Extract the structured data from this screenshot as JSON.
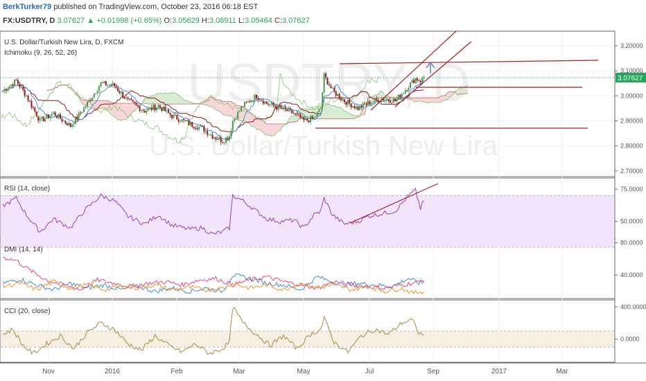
{
  "header": {
    "author": "BerkTurker79",
    "published": "published on TradingView.com, October 23, 2016 06:18 EST",
    "symbol": "FX:USDTRY, D",
    "last": "3.07627",
    "change": "+0.01998 (+0.65%)",
    "o_label": "O:",
    "o_value": "3.05629",
    "h_label": "H:",
    "h_value": "3.08911",
    "l_label": "L:",
    "l_value": "3.05464",
    "c_label": "C:",
    "c_value": "3.07627"
  },
  "colors": {
    "candle_up": "#4a9a4a",
    "candle_down": "#8b1a1a",
    "cloud_green": "#d8ecd2",
    "cloud_red": "#f6d6d6",
    "rsi": "#9b3fb3",
    "dmi_plus": "#3b8fd9",
    "dmi_minus": "#e8467c",
    "adx": "#f0922b",
    "cci": "#a88a3e",
    "trendline": "#a31d2a",
    "price_tag": "#26a65b"
  },
  "chart_data": [
    {
      "type": "candlestick",
      "title": "U.S. Dollar/Turkish New Lira, D, FXCM",
      "indicator": "Ichimoku (9, 26, 52, 26)",
      "watermark_symbol": "USDTRY, D",
      "watermark_name": "U.S. Dollar/Turkish New Lira",
      "y_ticks": [
        "3.20000",
        "3.10000",
        "3.00000",
        "2.90000",
        "2.80000",
        "2.70000"
      ],
      "ylim": [
        2.68,
        3.25
      ],
      "last_price_tag": "3.07627",
      "x_ticks": [
        "Nov",
        "2016",
        "Feb",
        "Mar",
        "May",
        "Jul",
        "Sep",
        "Nov",
        "2017",
        "Mar"
      ],
      "price_anchors": [
        [
          0,
          3.02
        ],
        [
          8,
          3.06
        ],
        [
          14,
          3.0
        ],
        [
          22,
          2.9
        ],
        [
          30,
          2.93
        ],
        [
          40,
          2.88
        ],
        [
          48,
          2.95
        ],
        [
          58,
          3.05
        ],
        [
          66,
          3.04
        ],
        [
          74,
          2.98
        ],
        [
          84,
          2.94
        ],
        [
          92,
          2.96
        ],
        [
          100,
          2.92
        ],
        [
          110,
          2.89
        ],
        [
          118,
          2.87
        ],
        [
          124,
          2.84
        ],
        [
          130,
          2.82
        ],
        [
          134,
          2.84
        ],
        [
          136,
          2.9
        ],
        [
          142,
          2.96
        ],
        [
          150,
          3.0
        ],
        [
          156,
          2.97
        ],
        [
          164,
          2.95
        ],
        [
          172,
          2.93
        ],
        [
          178,
          2.9
        ],
        [
          184,
          2.91
        ],
        [
          188,
          2.95
        ],
        [
          190,
          3.08
        ],
        [
          195,
          3.02
        ],
        [
          202,
          2.98
        ],
        [
          210,
          2.95
        ],
        [
          216,
          2.97
        ],
        [
          224,
          2.99
        ],
        [
          232,
          2.98
        ],
        [
          240,
          3.04
        ],
        [
          244,
          3.07
        ],
        [
          247,
          3.06
        ],
        [
          249,
          3.076
        ]
      ],
      "future_labels": [
        "Nov",
        "2017",
        "Mar"
      ]
    },
    {
      "type": "line",
      "title": "RSI (14, close)",
      "y_ticks": [
        "75.0000",
        "50.0000"
      ],
      "ylim": [
        38,
        82
      ],
      "band": [
        30,
        70
      ],
      "series": [
        {
          "anchors": [
            [
              0,
              62
            ],
            [
              8,
              68
            ],
            [
              14,
              55
            ],
            [
              22,
              42
            ],
            [
              30,
              52
            ],
            [
              40,
              45
            ],
            [
              48,
              58
            ],
            [
              58,
              70
            ],
            [
              66,
              66
            ],
            [
              74,
              54
            ],
            [
              84,
              48
            ],
            [
              92,
              55
            ],
            [
              100,
              47
            ],
            [
              110,
              44
            ],
            [
              118,
              45
            ],
            [
              124,
              40
            ],
            [
              130,
              42
            ],
            [
              134,
              45
            ],
            [
              136,
              70
            ],
            [
              142,
              66
            ],
            [
              150,
              58
            ],
            [
              156,
              52
            ],
            [
              164,
              50
            ],
            [
              172,
              51
            ],
            [
              178,
              45
            ],
            [
              184,
              55
            ],
            [
              188,
              58
            ],
            [
              190,
              68
            ],
            [
              195,
              55
            ],
            [
              202,
              48
            ],
            [
              210,
              50
            ],
            [
              216,
              54
            ],
            [
              224,
              56
            ],
            [
              232,
              58
            ],
            [
              240,
              70
            ],
            [
              244,
              74
            ],
            [
              247,
              60
            ],
            [
              249,
              66
            ]
          ]
        }
      ]
    },
    {
      "type": "line",
      "title": "DMI (14, 14)",
      "y_ticks": [
        "80.0000",
        "40.0000"
      ],
      "ylim": [
        12,
        82
      ],
      "series": [
        {
          "name": "+DI",
          "anchors": [
            [
              0,
              30
            ],
            [
              10,
              35
            ],
            [
              20,
              28
            ],
            [
              30,
              22
            ],
            [
              40,
              30
            ],
            [
              50,
              24
            ],
            [
              60,
              28
            ],
            [
              70,
              22
            ],
            [
              80,
              26
            ],
            [
              90,
              20
            ],
            [
              100,
              24
            ],
            [
              110,
              20
            ],
            [
              120,
              24
            ],
            [
              130,
              20
            ],
            [
              136,
              40
            ],
            [
              146,
              36
            ],
            [
              156,
              30
            ],
            [
              166,
              28
            ],
            [
              176,
              22
            ],
            [
              186,
              38
            ],
            [
              192,
              34
            ],
            [
              200,
              28
            ],
            [
              210,
              30
            ],
            [
              220,
              28
            ],
            [
              230,
              26
            ],
            [
              240,
              36
            ],
            [
              246,
              30
            ],
            [
              249,
              34
            ]
          ]
        },
        {
          "name": "-DI",
          "anchors": [
            [
              0,
              62
            ],
            [
              8,
              58
            ],
            [
              16,
              46
            ],
            [
              26,
              34
            ],
            [
              36,
              28
            ],
            [
              46,
              22
            ],
            [
              56,
              34
            ],
            [
              66,
              30
            ],
            [
              76,
              26
            ],
            [
              86,
              30
            ],
            [
              96,
              32
            ],
            [
              106,
              28
            ],
            [
              116,
              34
            ],
            [
              126,
              36
            ],
            [
              136,
              28
            ],
            [
              146,
              34
            ],
            [
              156,
              38
            ],
            [
              166,
              32
            ],
            [
              176,
              28
            ],
            [
              186,
              24
            ],
            [
              196,
              32
            ],
            [
              206,
              28
            ],
            [
              216,
              26
            ],
            [
              226,
              24
            ],
            [
              236,
              28
            ],
            [
              242,
              30
            ],
            [
              249,
              33
            ]
          ]
        },
        {
          "name": "ADX",
          "anchors": [
            [
              0,
              26
            ],
            [
              10,
              30
            ],
            [
              20,
              22
            ],
            [
              30,
              32
            ],
            [
              40,
              24
            ],
            [
              50,
              28
            ],
            [
              60,
              22
            ],
            [
              70,
              26
            ],
            [
              80,
              24
            ],
            [
              90,
              28
            ],
            [
              100,
              22
            ],
            [
              110,
              25
            ],
            [
              120,
              22
            ],
            [
              130,
              24
            ],
            [
              136,
              30
            ],
            [
              146,
              24
            ],
            [
              156,
              28
            ],
            [
              166,
              22
            ],
            [
              176,
              30
            ],
            [
              186,
              24
            ],
            [
              196,
              28
            ],
            [
              206,
              22
            ],
            [
              216,
              26
            ],
            [
              226,
              20
            ],
            [
              236,
              24
            ],
            [
              242,
              18
            ],
            [
              249,
              20
            ]
          ]
        }
      ]
    },
    {
      "type": "line",
      "title": "CCI (20, close)",
      "y_ticks": [
        "400.0000",
        "0.0000"
      ],
      "ylim": [
        -280,
        460
      ],
      "band": [
        -100,
        100
      ],
      "series": [
        {
          "anchors": [
            [
              0,
              60
            ],
            [
              6,
              120
            ],
            [
              12,
              -80
            ],
            [
              18,
              -180
            ],
            [
              26,
              -60
            ],
            [
              34,
              40
            ],
            [
              42,
              -120
            ],
            [
              50,
              80
            ],
            [
              58,
              200
            ],
            [
              66,
              120
            ],
            [
              74,
              -60
            ],
            [
              82,
              -140
            ],
            [
              90,
              40
            ],
            [
              98,
              -80
            ],
            [
              106,
              -160
            ],
            [
              114,
              -60
            ],
            [
              122,
              -180
            ],
            [
              130,
              -120
            ],
            [
              134,
              -40
            ],
            [
              136,
              400
            ],
            [
              142,
              200
            ],
            [
              150,
              60
            ],
            [
              158,
              -80
            ],
            [
              166,
              40
            ],
            [
              174,
              -120
            ],
            [
              182,
              60
            ],
            [
              188,
              120
            ],
            [
              190,
              260
            ],
            [
              196,
              -40
            ],
            [
              204,
              -160
            ],
            [
              212,
              40
            ],
            [
              220,
              120
            ],
            [
              228,
              60
            ],
            [
              236,
              200
            ],
            [
              242,
              240
            ],
            [
              246,
              80
            ],
            [
              249,
              40
            ]
          ]
        }
      ]
    }
  ]
}
